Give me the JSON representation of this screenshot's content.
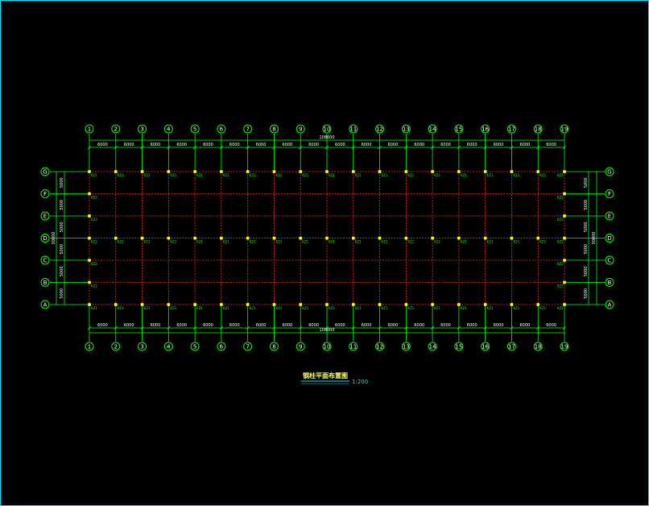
{
  "drawing": {
    "title": "钢柱平面布置图",
    "scale": "1:200",
    "total_length": "108000",
    "total_width": "30000",
    "column_axes": [
      "1",
      "2",
      "3",
      "4",
      "5",
      "6",
      "7",
      "8",
      "9",
      "10",
      "11",
      "12",
      "13",
      "14",
      "15",
      "16",
      "17",
      "18",
      "19"
    ],
    "row_axes": [
      "A",
      "B",
      "C",
      "D",
      "E",
      "F",
      "G"
    ],
    "bay_spacings": [
      "6000",
      "6000",
      "6000",
      "6000",
      "6000",
      "6000",
      "6000",
      "6000",
      "6000",
      "6000",
      "6000",
      "6000",
      "6000",
      "6000",
      "6000",
      "6000",
      "6000",
      "6000"
    ],
    "row_spacings": [
      "5000",
      "5000",
      "5000",
      "5000",
      "5000",
      "5000"
    ],
    "column_tag_main": "KZ1",
    "column_tag_end": "KZ2",
    "colors": {
      "frame": "#00e5ff",
      "axis_bubbles": "#00ff00",
      "grid_lines": "#ff2a2a",
      "columns": "#ffff00",
      "title": "#ffff66"
    }
  }
}
